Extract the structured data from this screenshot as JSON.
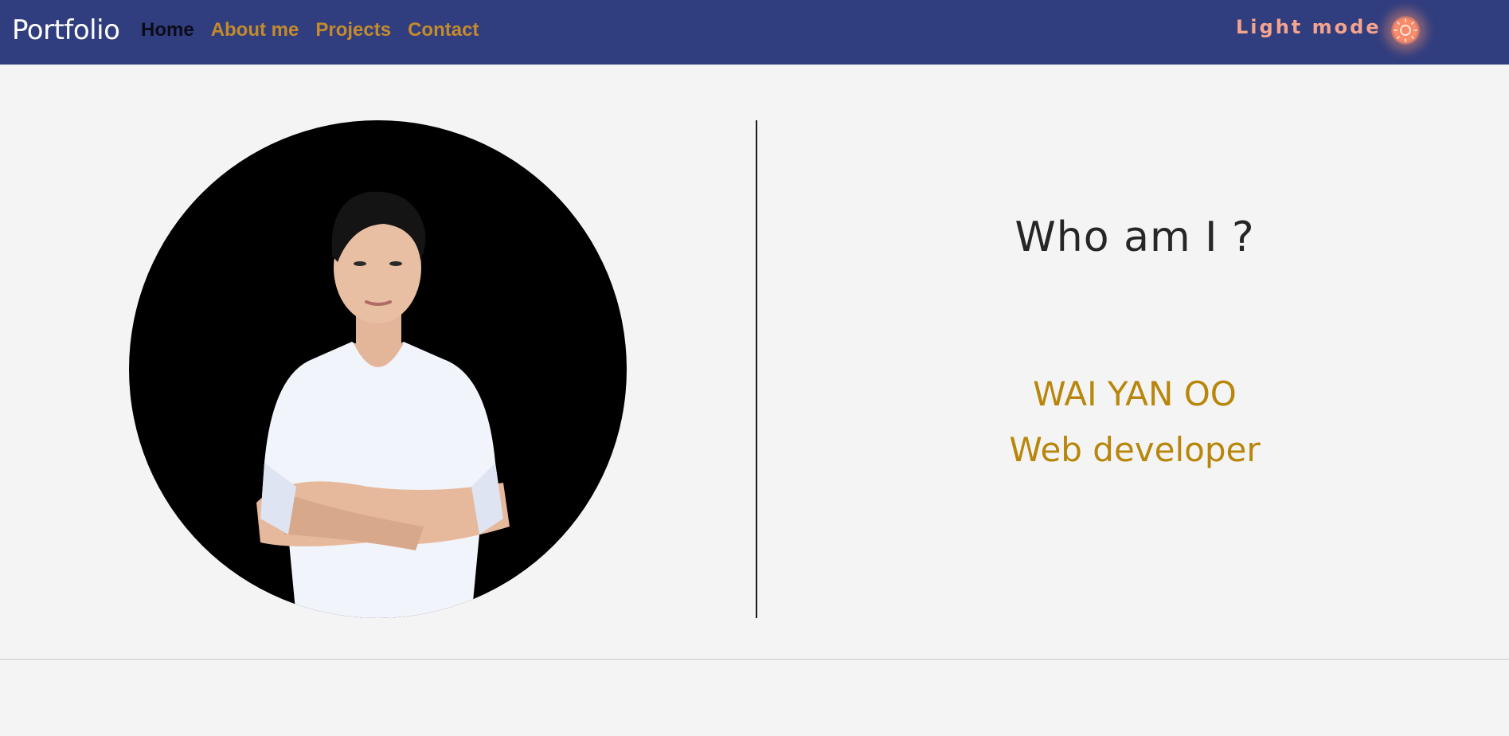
{
  "navbar": {
    "brand": "Portfolio",
    "links": [
      {
        "label": "Home",
        "active": true
      },
      {
        "label": "About me",
        "active": false
      },
      {
        "label": "Projects",
        "active": false
      },
      {
        "label": "Contact",
        "active": false
      }
    ],
    "mode_label": "Light mode",
    "mode_icon": "sun-icon"
  },
  "hero": {
    "title": "Who am I ?",
    "name": "WAI YAN OO",
    "role": "Web developer",
    "photo": "profile-photo"
  },
  "colors": {
    "navbar_bg": "#303d7f",
    "link": "#c48b2c",
    "link_active": "#0c0c18",
    "mode_label": "#f4a48c",
    "accent_text": "#b8860b",
    "page_bg": "#f4f4f4"
  }
}
